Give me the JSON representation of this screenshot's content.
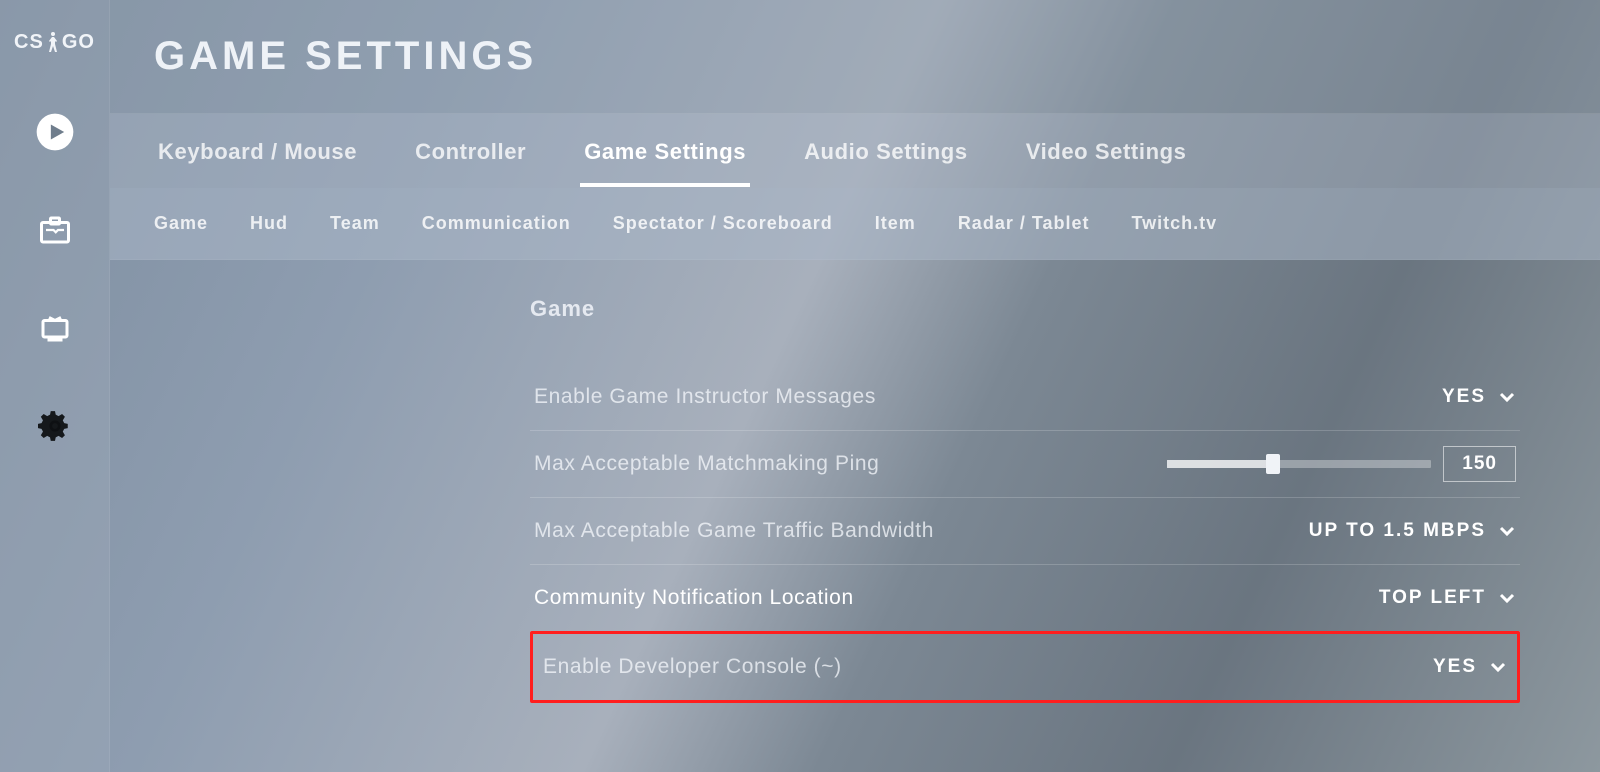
{
  "header": {
    "title": "GAME SETTINGS"
  },
  "sidebar": {
    "logo_left": "CS",
    "logo_right": "GO"
  },
  "tabs_major": [
    {
      "label": "Keyboard / Mouse",
      "active": false
    },
    {
      "label": "Controller",
      "active": false
    },
    {
      "label": "Game Settings",
      "active": true
    },
    {
      "label": "Audio Settings",
      "active": false
    },
    {
      "label": "Video Settings",
      "active": false
    }
  ],
  "tabs_minor": [
    {
      "label": "Game"
    },
    {
      "label": "Hud"
    },
    {
      "label": "Team"
    },
    {
      "label": "Communication"
    },
    {
      "label": "Spectator / Scoreboard"
    },
    {
      "label": "Item"
    },
    {
      "label": "Radar / Tablet"
    },
    {
      "label": "Twitch.tv"
    }
  ],
  "section": {
    "heading": "Game",
    "rows": [
      {
        "label": "Enable Game Instructor Messages",
        "type": "dropdown",
        "value": "YES"
      },
      {
        "label": "Max Acceptable Matchmaking Ping",
        "type": "slider",
        "value": "150",
        "fill_pct": 40
      },
      {
        "label": "Max Acceptable Game Traffic Bandwidth",
        "type": "dropdown",
        "value": "UP TO 1.5 MBPS"
      },
      {
        "label": "Community Notification Location",
        "type": "dropdown",
        "value": "TOP LEFT",
        "bright": true
      },
      {
        "label": "Enable Developer Console (~)",
        "type": "dropdown",
        "value": "YES",
        "highlight": true
      }
    ]
  }
}
